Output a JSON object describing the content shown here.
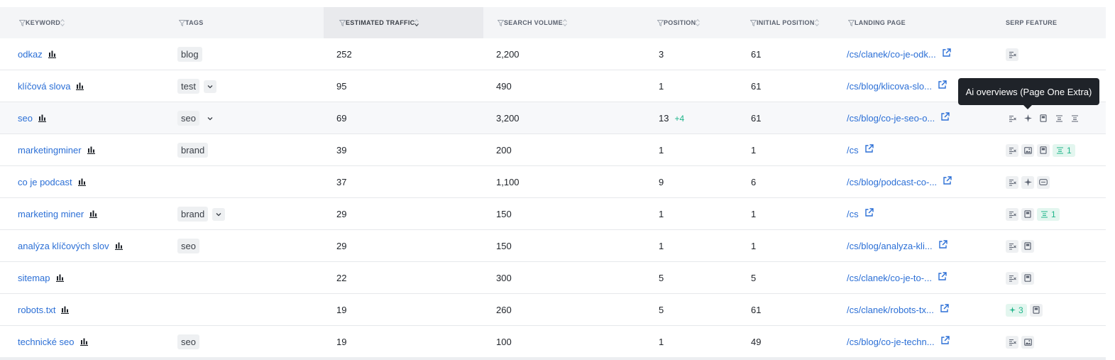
{
  "columns": [
    {
      "label": "KEYWORD"
    },
    {
      "label": "TAGS"
    },
    {
      "label": "ESTIMATED TRAFFIC"
    },
    {
      "label": "SEARCH VOLUME"
    },
    {
      "label": "POSITION"
    },
    {
      "label": "INITIAL POSITION"
    },
    {
      "label": "LANDING PAGE"
    },
    {
      "label": "SERP FEATURE"
    }
  ],
  "rows": [
    {
      "keyword": "odkaz",
      "tag": "blog",
      "tag_drop": "none",
      "traffic": "252",
      "volume": "2,200",
      "position": "3",
      "delta": "",
      "initial": "61",
      "landing": "/cs/clanek/co-je-odk...",
      "serp": [
        "snippet"
      ],
      "highlight": false
    },
    {
      "keyword": "klíčová slova",
      "tag": "test",
      "tag_drop": "box",
      "traffic": "95",
      "volume": "490",
      "position": "1",
      "delta": "",
      "initial": "61",
      "landing": "/cs/blog/klicova-slo...",
      "serp": [],
      "highlight": false
    },
    {
      "keyword": "seo",
      "tag": "seo",
      "tag_drop": "plain",
      "traffic": "69",
      "volume": "3,200",
      "position": "13",
      "delta": "+4",
      "initial": "61",
      "landing": "/cs/blog/co-je-seo-o...",
      "serp": [
        "snippet-bare",
        "sparkle-bare",
        "book-bare",
        "list-bare",
        "list-bare"
      ],
      "highlight": true
    },
    {
      "keyword": "marketingminer",
      "tag": "brand",
      "tag_drop": "none",
      "traffic": "39",
      "volume": "200",
      "position": "1",
      "delta": "",
      "initial": "1",
      "landing": "/cs",
      "serp": [
        "snippet",
        "image",
        "book",
        "badge-list:1"
      ],
      "highlight": false
    },
    {
      "keyword": "co je podcast",
      "tag": "",
      "tag_drop": "none",
      "traffic": "37",
      "volume": "1,100",
      "position": "9",
      "delta": "",
      "initial": "6",
      "landing": "/cs/blog/podcast-co-...",
      "serp": [
        "snippet",
        "sparkle",
        "card"
      ],
      "highlight": false
    },
    {
      "keyword": "marketing miner",
      "tag": "brand",
      "tag_drop": "box",
      "traffic": "29",
      "volume": "150",
      "position": "1",
      "delta": "",
      "initial": "1",
      "landing": "/cs",
      "serp": [
        "snippet",
        "book",
        "badge-list:1"
      ],
      "highlight": false
    },
    {
      "keyword": "analýza klíčových slov",
      "tag": "seo",
      "tag_drop": "none",
      "traffic": "29",
      "volume": "150",
      "position": "1",
      "delta": "",
      "initial": "1",
      "landing": "/cs/blog/analyza-kli...",
      "serp": [
        "snippet",
        "book"
      ],
      "highlight": false
    },
    {
      "keyword": "sitemap",
      "tag": "",
      "tag_drop": "none",
      "traffic": "22",
      "volume": "300",
      "position": "5",
      "delta": "",
      "initial": "5",
      "landing": "/cs/clanek/co-je-to-...",
      "serp": [
        "snippet",
        "book"
      ],
      "highlight": false
    },
    {
      "keyword": "robots.txt",
      "tag": "",
      "tag_drop": "none",
      "traffic": "19",
      "volume": "260",
      "position": "5",
      "delta": "",
      "initial": "61",
      "landing": "/cs/clanek/robots-tx...",
      "serp": [
        "badge-sparkle:3",
        "book"
      ],
      "highlight": false
    },
    {
      "keyword": "technické seo",
      "tag": "seo",
      "tag_drop": "none",
      "traffic": "19",
      "volume": "100",
      "position": "1",
      "delta": "",
      "initial": "49",
      "landing": "/cs/blog/co-je-techn...",
      "serp": [
        "snippet",
        "image"
      ],
      "highlight": false
    }
  ],
  "tooltip": "Ai overviews (Page One Extra)",
  "colors": {
    "link": "#2b6fd6",
    "accent_green": "#1fb58a",
    "header_bg": "#f4f5f7",
    "tooltip_bg": "#1f2329"
  }
}
